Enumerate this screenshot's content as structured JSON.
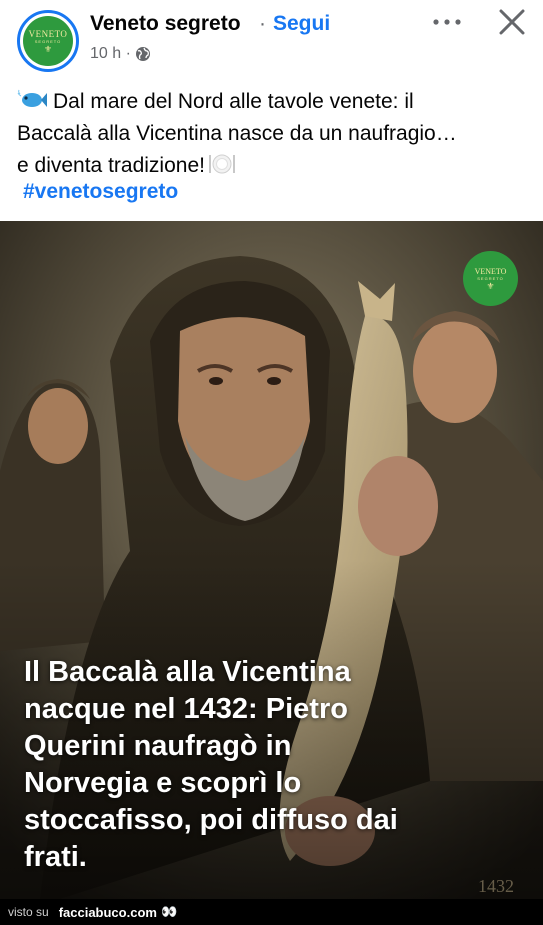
{
  "header": {
    "page_name": "Veneto segreto",
    "separator": "·",
    "follow_label": "Segui",
    "time": "10 h ·",
    "avatar_logo": {
      "text": "VENETO",
      "sub": "SEGRETO",
      "mark": "⚜"
    }
  },
  "post": {
    "lines": [
      "Dal mare del Nord alle tavole venete: il",
      "Baccalà alla Vicentina nasce da un naufragio…",
      "e diventa tradizione!"
    ],
    "hashtag": "#venetosegreto",
    "emoji_icons": [
      "fish-icon",
      "plate-cutlery-icon"
    ]
  },
  "image": {
    "logo": {
      "text": "VENETO",
      "sub": "SEGRETO",
      "mark": "⚜"
    },
    "caption_lines": [
      "Il Baccalà alla Vicentina",
      "nacque nel 1432: Pietro",
      "Querini naufragò in",
      "Norvegia e scoprì lo",
      "stoccafisso, poi diffuso dai",
      "frati."
    ],
    "year_stamp": "1432"
  },
  "footer": {
    "visto": "visto su",
    "brand": "facciabuco.com",
    "eyes": "👀"
  },
  "colors": {
    "accent": "#1877f2",
    "logo_green": "#2e9a3e",
    "meta_gray": "#65676b"
  }
}
